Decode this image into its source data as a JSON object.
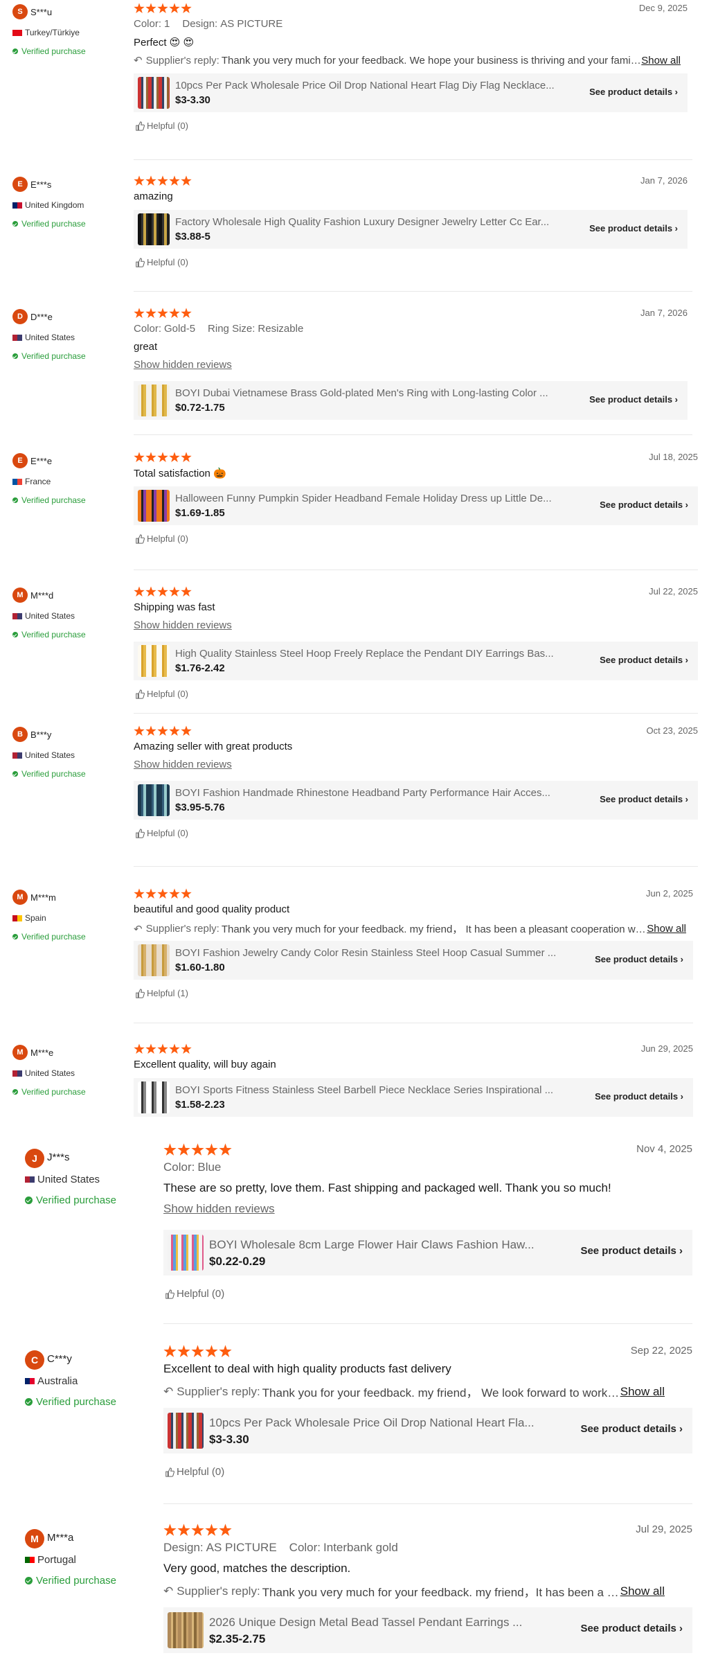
{
  "reviews": [
    {
      "avatar_letter": "S",
      "username": "S***u",
      "country": "Turkey/Türkiye",
      "flag_colors": [
        "#e30a17"
      ],
      "verified": "Verified purchase",
      "stars": 5,
      "date": "Dec 9, 2025",
      "attributes": [
        {
          "label": "Color:",
          "value": "1"
        },
        {
          "label": "Design:",
          "value": "AS PICTURE"
        }
      ],
      "text": "Perfect 😍 😍",
      "reply_label": "Supplier's reply:",
      "reply_text": "Thank you very much for your feedback. We hope your business is thriving and your family is happy.",
      "show_all": "Show all",
      "product_title": "10pcs Per Pack Wholesale Price Oil Drop National Heart Flag Diy Flag Necklace...",
      "product_price": "$3-3.30",
      "see_details": "See product details",
      "thumb_colors": [
        "#c33",
        "#346",
        "#eee",
        "#963"
      ],
      "helpful": "Helpful (0)"
    },
    {
      "avatar_letter": "E",
      "username": "E***s",
      "country": "United Kingdom",
      "flag_colors": [
        "#012169",
        "#c8102e"
      ],
      "verified": "Verified purchase",
      "stars": 5,
      "date": "Jan 7, 2026",
      "text": "amazing",
      "product_title": "Factory Wholesale High Quality Fashion Luxury Designer Jewelry Letter Cc Ear...",
      "product_price": "$3.88-5",
      "see_details": "See product details",
      "thumb_colors": [
        "#111",
        "#333",
        "#c9a646",
        "#222"
      ],
      "helpful": "Helpful (0)"
    },
    {
      "avatar_letter": "D",
      "username": "D***e",
      "country": "United States",
      "flag_colors": [
        "#b22234",
        "#3c3b6e"
      ],
      "verified": "Verified purchase",
      "stars": 5,
      "date": "Jan 7, 2026",
      "attributes": [
        {
          "label": "Color:",
          "value": "Gold-5"
        },
        {
          "label": "Ring Size:",
          "value": "Resizable"
        }
      ],
      "text": "great",
      "hidden_reviews": "Show hidden reviews",
      "product_title": "BOYI Dubai Vietnamese Brass Gold-plated Men's Ring with Long-lasting Color ...",
      "product_price": "$0.72-1.75",
      "see_details": "See product details",
      "thumb_colors": [
        "#f4f0e6",
        "#d4a531",
        "#e0b84a",
        "#f4f0e6"
      ]
    },
    {
      "avatar_letter": "E",
      "username": "E***e",
      "country": "France",
      "flag_colors": [
        "#0055a4",
        "#ef4135"
      ],
      "verified": "Verified purchase",
      "stars": 5,
      "date": "Jul 18, 2025",
      "text": "Total satisfaction 🎃",
      "product_title": "Halloween Funny Pumpkin Spider Headband Female Holiday Dress up Little De...",
      "product_price": "$1.69-1.85",
      "see_details": "See product details",
      "thumb_colors": [
        "#f07a1a",
        "#222",
        "#8b3ea8",
        "#f07a1a"
      ],
      "helpful": "Helpful (0)"
    },
    {
      "avatar_letter": "M",
      "username": "M***d",
      "country": "United States",
      "flag_colors": [
        "#b22234",
        "#3c3b6e"
      ],
      "verified": "Verified purchase",
      "stars": 5,
      "date": "Jul 22, 2025",
      "text": "Shipping was fast",
      "hidden_reviews": "Show hidden reviews",
      "product_title": "High Quality Stainless Steel Hoop Freely Replace the Pendant DIY Earrings Bas...",
      "product_price": "$1.76-2.42",
      "see_details": "See product details",
      "thumb_colors": [
        "#fdfaf1",
        "#d9a32b",
        "#e7bb4c",
        "#fdfaf1"
      ],
      "helpful": "Helpful (0)"
    },
    {
      "avatar_letter": "B",
      "username": "B***y",
      "country": "United States",
      "flag_colors": [
        "#b22234",
        "#3c3b6e"
      ],
      "verified": "Verified purchase",
      "stars": 5,
      "date": "Oct 23, 2025",
      "text": "Amazing seller with great products",
      "hidden_reviews": "Show hidden reviews",
      "product_title": "BOYI Fashion Handmade Rhinestone Headband Party Performance Hair Acces...",
      "product_price": "$3.95-5.76",
      "see_details": "See product details",
      "thumb_colors": [
        "#1d3a4f",
        "#335c78",
        "#9cc",
        "#1d3a4f"
      ],
      "helpful": "Helpful (0)"
    },
    {
      "avatar_letter": "M",
      "username": "M***m",
      "country": "Spain",
      "flag_colors": [
        "#c60b1e",
        "#ffc400"
      ],
      "verified": "Verified purchase",
      "stars": 5,
      "date": "Jun 2, 2025",
      "text": "beautiful and good quality product",
      "reply_label": "Supplier's reply:",
      "reply_text": "Thank you very much for your feedback. my friend， It has been a pleasant cooperation with you.",
      "show_all": "Show all",
      "product_title": "BOYI Fashion Jewelry Candy Color Resin Stainless Steel Hoop Casual Summer ...",
      "product_price": "$1.60-1.80",
      "see_details": "See product details",
      "thumb_colors": [
        "#e8dccb",
        "#c79b3c",
        "#d6b06a",
        "#e8dccb"
      ],
      "helpful": "Helpful (1)"
    },
    {
      "avatar_letter": "M",
      "username": "M***e",
      "country": "United States",
      "flag_colors": [
        "#b22234",
        "#3c3b6e"
      ],
      "verified": "Verified purchase",
      "stars": 5,
      "date": "Jun 29, 2025",
      "text": "Excellent quality, will buy again",
      "product_title": "BOYI Sports Fitness Stainless Steel Barbell Piece Necklace Series Inspirational ...",
      "product_price": "$1.58-2.23",
      "see_details": "See product details",
      "thumb_colors": [
        "#fff",
        "#333",
        "#888",
        "#fff"
      ]
    },
    {
      "avatar_letter": "J",
      "username": "J***s",
      "country": "United States",
      "flag_colors": [
        "#b22234",
        "#3c3b6e"
      ],
      "verified": "Verified purchase",
      "stars": 5,
      "date": "Nov 4, 2025",
      "attributes": [
        {
          "label": "Color:",
          "value": "Blue"
        }
      ],
      "text": "These are so pretty, love them. Fast shipping and packaged well. Thank you so much!",
      "hidden_reviews": "Show hidden reviews",
      "product_title": "BOYI Wholesale 8cm Large Flower Hair Claws Fashion Haw...",
      "product_price": "$0.22-0.29",
      "see_details": "See product details",
      "thumb_colors": [
        "#f3f3f3",
        "#e05a8a",
        "#5aa0e0",
        "#f0c040"
      ],
      "helpful": "Helpful (0)"
    },
    {
      "avatar_letter": "C",
      "username": "C***y",
      "country": "Australia",
      "flag_colors": [
        "#012169",
        "#e4002b"
      ],
      "verified": "Verified purchase",
      "stars": 5,
      "date": "Sep 22, 2025",
      "text": "Excellent to deal with high quality products fast delivery",
      "reply_label": "Supplier's reply:",
      "reply_text": "Thank you for your feedback. my friend， We look forward to working with you again.",
      "show_all": "Show all",
      "product_title": "10pcs Per Pack Wholesale Price Oil Drop National Heart Fla...",
      "product_price": "$3-3.30",
      "see_details": "See product details",
      "thumb_colors": [
        "#c33",
        "#346",
        "#eee",
        "#963"
      ],
      "helpful": "Helpful (0)"
    },
    {
      "avatar_letter": "M",
      "username": "M***a",
      "country": "Portugal",
      "flag_colors": [
        "#006600",
        "#ff0000"
      ],
      "verified": "Verified purchase",
      "stars": 5,
      "date": "Jul 29, 2025",
      "attributes": [
        {
          "label": "Design:",
          "value": "AS PICTURE"
        },
        {
          "label": "Color:",
          "value": "Interbank gold"
        }
      ],
      "text": "Very good, matches the description.",
      "reply_label": "Supplier's reply:",
      "reply_text": "Thank you very much for your feedback. my friend，It has been a pleasure.",
      "show_all": "Show all",
      "product_title": "2026 Unique Design Metal Bead Tassel Pendant Earrings ...",
      "product_price": "$2.35-2.75",
      "see_details": "See product details",
      "thumb_colors": [
        "#b08a5a",
        "#d9b67a",
        "#8a6a3a",
        "#c9a26a"
      ]
    }
  ]
}
